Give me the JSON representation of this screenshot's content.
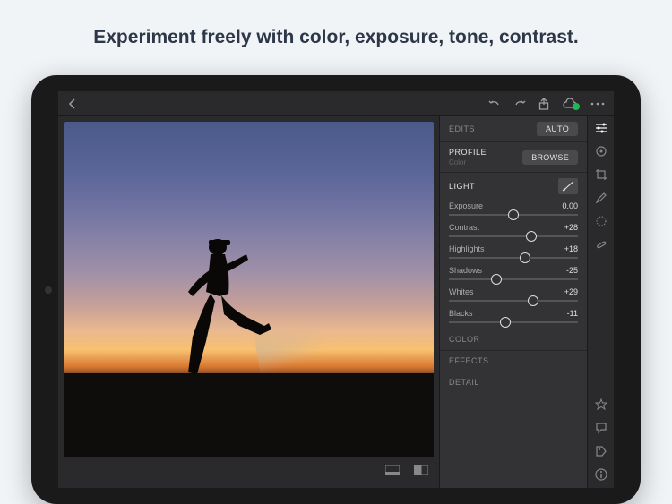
{
  "headline": "Experiment freely with color, exposure, tone, contrast.",
  "panel": {
    "edits_label": "EDITS",
    "auto_label": "AUTO",
    "profile_label": "PROFILE",
    "profile_value": "Color",
    "browse_label": "BROWSE",
    "light_label": "LIGHT",
    "collapsed": {
      "color": "COLOR",
      "effects": "EFFECTS",
      "detail": "DETAIL"
    }
  },
  "sliders": [
    {
      "name": "Exposure",
      "value": "0.00",
      "pos": 50
    },
    {
      "name": "Contrast",
      "value": "+28",
      "pos": 64
    },
    {
      "name": "Highlights",
      "value": "+18",
      "pos": 59
    },
    {
      "name": "Shadows",
      "value": "-25",
      "pos": 37
    },
    {
      "name": "Whites",
      "value": "+29",
      "pos": 65
    },
    {
      "name": "Blacks",
      "value": "-11",
      "pos": 44
    }
  ]
}
